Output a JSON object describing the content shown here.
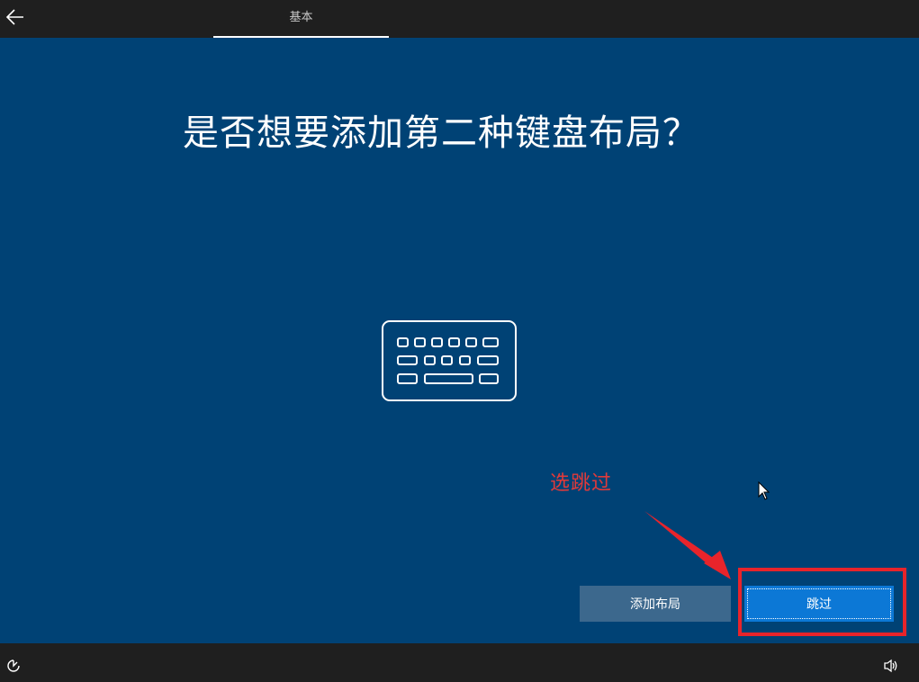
{
  "header": {
    "back_icon": "arrow-left-icon",
    "tab_label": "基本"
  },
  "main": {
    "title": "是否想要添加第二种键盘布局？",
    "illustration_icon": "keyboard-icon"
  },
  "annotation": {
    "text": "选跳过",
    "color": "#e03a3a"
  },
  "actions": {
    "add_layout_label": "添加布局",
    "skip_label": "跳过"
  },
  "footer": {
    "ease_of_access_icon": "ease-of-access-icon",
    "volume_icon": "volume-icon"
  },
  "colors": {
    "background": "#004275",
    "bar": "#1f1f1f",
    "primary_button": "#0c78d6",
    "secondary_button": "#3c688d",
    "highlight": "#e8242b"
  }
}
